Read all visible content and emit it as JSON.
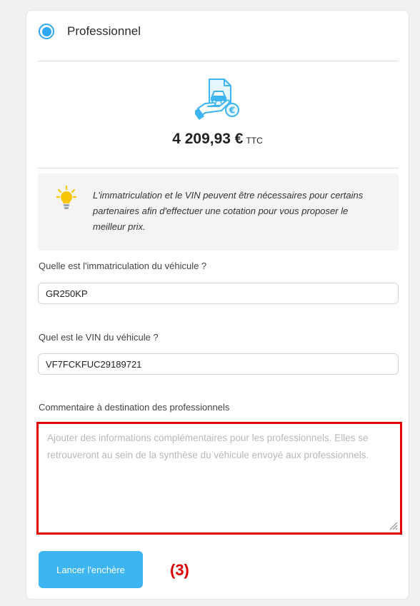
{
  "option": {
    "label": "Professionnel",
    "selected": true
  },
  "price": {
    "amount": "4 209,93 €",
    "suffix": "TTC"
  },
  "info": {
    "text": "L'immatriculation et le VIN peuvent être nécessaires pour certains partenaires afin d'effectuer une cotation pour vous proposer le meilleur prix."
  },
  "fields": {
    "registration_label": "Quelle est l'immatriculation du véhicule ?",
    "registration_value": "GR250KP",
    "vin_label": "Quel est le VIN du véhicule ?",
    "vin_value": "VF7FCKFUC29189721",
    "comment_label": "Commentaire à destination des professionnels",
    "comment_placeholder": "Ajouter des informations complémentaires pour les professionnels. Elles se retrouveront au sein de la synthèse du véhicule envoyé aux professionnels."
  },
  "actions": {
    "submit_label": "Lancer l'enchère"
  },
  "annotation": {
    "step_label": "(3)",
    "color": "#e00000"
  },
  "colors": {
    "accent": "#3db5f1",
    "highlight": "#e00000",
    "bulb": "#f7c600"
  },
  "icons": {
    "illustration": "car-document-euro-icon",
    "info": "lightbulb-icon"
  }
}
